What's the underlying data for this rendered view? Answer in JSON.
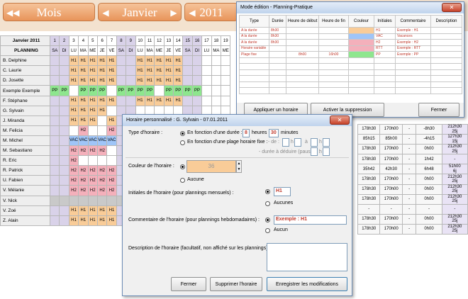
{
  "header": {
    "mois_label": "Mois",
    "mois_value": "Janvier",
    "year_value": "2011"
  },
  "planning": {
    "title": "Janvier 2011",
    "subtitle": "PLANNING",
    "day_numbers": [
      "1",
      "2",
      "3",
      "4",
      "5",
      "6",
      "7",
      "8",
      "9",
      "10",
      "11",
      "12",
      "13",
      "14",
      "15",
      "16",
      "17",
      "18",
      "19"
    ],
    "day_letters": [
      "SA",
      "DI",
      "LU",
      "MA",
      "ME",
      "JE",
      "VE",
      "SA",
      "DI",
      "LU",
      "MA",
      "ME",
      "JE",
      "VE",
      "SA",
      "DI",
      "LU",
      "MA",
      "ME"
    ],
    "rows": [
      {
        "name": "B. Delphine",
        "cells": [
          "",
          "",
          "H1",
          "H1",
          "H1",
          "H1",
          "H1",
          "",
          "",
          "H1",
          "H1",
          "H1",
          "H1",
          "H1",
          "",
          "",
          "",
          "",
          ""
        ]
      },
      {
        "name": "C. Laurie",
        "cells": [
          "",
          "",
          "H1",
          "H1",
          "H1",
          "H1",
          "H1",
          "",
          "",
          "H1",
          "H1",
          "H1",
          "H1",
          "H1",
          "",
          "",
          "",
          "",
          ""
        ]
      },
      {
        "name": "D. Josette",
        "cells": [
          "",
          "",
          "H1",
          "H1",
          "H1",
          "H1",
          "H1",
          "",
          "",
          "H1",
          "H1",
          "H1",
          "H1",
          "H1",
          "",
          "",
          "",
          "",
          ""
        ]
      },
      {
        "name": "Exemple Exemple",
        "cells": [
          "PP",
          "PP",
          "",
          "PP",
          "PP",
          "PP",
          "",
          "PP",
          "PP",
          "PP",
          "PP",
          "",
          "PP",
          "PP",
          "PP",
          "PP",
          "",
          "",
          ""
        ]
      },
      {
        "name": "F. Stéphane",
        "cells": [
          "",
          "",
          "H1",
          "H1",
          "H1",
          "H1",
          "H1",
          "",
          "",
          "H1",
          "H1",
          "H1",
          "H1",
          "H1",
          "",
          "",
          "",
          "",
          ""
        ]
      },
      {
        "name": "G. Sylvain",
        "cells": [
          "",
          "",
          "H1",
          "H1",
          "H1",
          "H1",
          "",
          "",
          "",
          "",
          "",
          "",
          "",
          "",
          "",
          "",
          "",
          "",
          ""
        ]
      },
      {
        "name": "J. Miranda",
        "cells": [
          "",
          "",
          "H1",
          "H1",
          "H1",
          "",
          "H1",
          "",
          "",
          "",
          "",
          "",
          "",
          "",
          "",
          "",
          "",
          "",
          ""
        ]
      },
      {
        "name": "M. Felicia",
        "cells": [
          "",
          "",
          "",
          "H2",
          "",
          "",
          "H2",
          "",
          "",
          "",
          "",
          "",
          "",
          "",
          "",
          "",
          "",
          "",
          ""
        ]
      },
      {
        "name": "M. Michel",
        "cells": [
          "",
          "",
          "VAC",
          "VAC",
          "VAC",
          "VAC",
          "VAC",
          "",
          "",
          "",
          "",
          "",
          "",
          "",
          "",
          "",
          "",
          "",
          ""
        ]
      },
      {
        "name": "M. Sebastiano",
        "cells": [
          "",
          "",
          "H2",
          "H2",
          "H2",
          "H2",
          "",
          "",
          "",
          "",
          "",
          "",
          "",
          "",
          "",
          "",
          "",
          "",
          ""
        ]
      },
      {
        "name": "R. Eric",
        "cells": [
          "",
          "",
          "H2",
          "",
          "",
          "",
          "",
          "",
          "",
          "",
          "",
          "",
          "",
          "",
          "",
          "",
          "",
          "",
          ""
        ]
      },
      {
        "name": "R. Patrick",
        "cells": [
          "",
          "",
          "H2",
          "H2",
          "H2",
          "H2",
          "H2",
          "",
          "",
          "",
          "",
          "",
          "",
          "",
          "",
          "",
          "",
          "",
          ""
        ]
      },
      {
        "name": "U. Fabien",
        "cells": [
          "",
          "",
          "H2",
          "H2",
          "H2",
          "H2",
          "H2",
          "",
          "",
          "",
          "",
          "",
          "",
          "",
          "",
          "",
          "",
          "",
          ""
        ]
      },
      {
        "name": "V. Mélanie",
        "cells": [
          "",
          "",
          "H2",
          "H2",
          "H2",
          "H2",
          "H2",
          "",
          "",
          "",
          "",
          "",
          "",
          "",
          "",
          "",
          "",
          "",
          ""
        ]
      },
      {
        "name": "V. Nick",
        "cells": [
          "",
          "",
          "",
          "",
          "",
          "",
          "",
          "",
          "",
          "",
          "",
          "",
          "",
          "",
          "",
          "",
          "",
          "",
          ""
        ]
      },
      {
        "name": "V. Zoé",
        "cells": [
          "",
          "",
          "H1",
          "H1",
          "H1",
          "H1",
          "H1",
          "",
          "",
          "",
          "",
          "",
          "",
          "",
          "",
          "",
          "",
          "",
          ""
        ]
      },
      {
        "name": "Z. Alain",
        "cells": [
          "",
          "",
          "H1",
          "H1",
          "H1",
          "H1",
          "H1",
          "",
          "",
          "",
          "",
          "",
          "",
          "",
          "",
          "",
          "",
          "",
          ""
        ]
      }
    ],
    "right_rows": [
      {
        "r": "J. Miranda",
        "a": "178h30",
        "b": "170h00",
        "c": "-",
        "d": "-8h30",
        "e": "212h30",
        "f": "25j"
      },
      {
        "r": "M. Felicia",
        "a": "85h15",
        "b": "85h00",
        "c": "-",
        "d": "-4h15",
        "e": "127h30",
        "f": "15j"
      },
      {
        "r": "M. Michel",
        "a": "178h30",
        "b": "170h00",
        "c": "-",
        "d": "0h00",
        "e": "212h30",
        "f": "25j"
      },
      {
        "r": "M. Sebastiano",
        "a": "178h30",
        "b": "170h00",
        "c": "-",
        "d": "1h42",
        "e": "-",
        "f": ""
      },
      {
        "r": "R. Eric",
        "a": "35h42",
        "b": "42h30",
        "c": "-",
        "d": "6h48",
        "e": "51h00",
        "f": "6j"
      },
      {
        "r": "R. Patrick",
        "a": "178h30",
        "b": "170h00",
        "c": "-",
        "d": "0h00",
        "e": "212h30",
        "f": "25j"
      },
      {
        "r": "U. Fabien",
        "a": "178h30",
        "b": "170h00",
        "c": "-",
        "d": "0h00",
        "e": "212h30",
        "f": "25j"
      },
      {
        "r": "V. Mélanie",
        "a": "178h30",
        "b": "170h00",
        "c": "-",
        "d": "0h00",
        "e": "212h30",
        "f": "25j"
      },
      {
        "r": "V. Nick",
        "a": "-",
        "b": "-",
        "c": "-",
        "d": "-",
        "e": "-",
        "f": ""
      },
      {
        "r": "V. Zoé",
        "a": "178h30",
        "b": "170h00",
        "c": "-",
        "d": "0h00",
        "e": "212h30",
        "f": "25j"
      },
      {
        "r": "Z. Alain",
        "a": "178h30",
        "b": "170h00",
        "c": "-",
        "d": "0h00",
        "e": "212h30",
        "f": "25j"
      }
    ]
  },
  "mode_edition": {
    "title": "Mode édition - Planning-Pratique",
    "headers": [
      "Type",
      "Durée",
      "Heure de début",
      "Heure de fin",
      "Couleur",
      "Initiales",
      "Commentaire",
      "Description"
    ],
    "rows": [
      {
        "type": "A la durée",
        "duree": "8h30",
        "debut": "",
        "fin": "",
        "color": "#f9cc98",
        "initiales": "H1",
        "commentaire": "Exemple : H1"
      },
      {
        "type": "A la durée",
        "duree": "8h30",
        "debut": "",
        "fin": "",
        "color": "#9fc5f8",
        "initiales": "VAC",
        "commentaire": "Vacances"
      },
      {
        "type": "A la durée",
        "duree": "8h30",
        "debut": "",
        "fin": "",
        "color": "#f4b0bb",
        "initiales": "H2",
        "commentaire": "Exemple : H2"
      },
      {
        "type": "Horaire variable",
        "duree": "",
        "debut": "",
        "fin": "",
        "color": "#f4b0bb",
        "initiales": "RTT",
        "commentaire": "Exemple : RTT"
      },
      {
        "type": "Plage fixe",
        "duree": "",
        "debut": "8h00",
        "fin": "16h00",
        "color": "#8ee68e",
        "initiales": "PP",
        "commentaire": "Exemple : PP"
      }
    ],
    "btn_apply": "Appliquer un horaire",
    "btn_delete": "Activer la suppression",
    "btn_close": "Fermer"
  },
  "dialog": {
    "title": "Horaire personnalisé : G. Sylvain - 07.01.2011",
    "type_label": "Type d'horaire :",
    "opt_duration": "En fonction d'une durée :",
    "hours_value": "8",
    "hours_unit": "heures",
    "minutes_value": "30",
    "minutes_unit": "minutes",
    "opt_fixed": "En fonction d'une plage horaire fixe :",
    "de_label": "- de :",
    "h_sym": "h",
    "a_label": "à",
    "deduct_label": "- durée à déduire (pauses) :",
    "color_label": "Couleur de l'horaire :",
    "color_value": "36",
    "color_none": "Aucune",
    "initials_label": "Initiales de l'horaire (pour plannings mensuels) :",
    "initials_value": "H1",
    "initials_none": "Aucunes",
    "comment_label": "Commentaire de l'horaire (pour plannings hebdomadaires) :",
    "comment_value": "Exemple : H1",
    "comment_none": "Aucun",
    "desc_label": "Description de l'horaire (facultatif, non affiché sur les plannings) :",
    "btn_close": "Fermer",
    "btn_delete": "Supprimer l'horaire",
    "btn_save": "Enregistrer les modifications"
  }
}
